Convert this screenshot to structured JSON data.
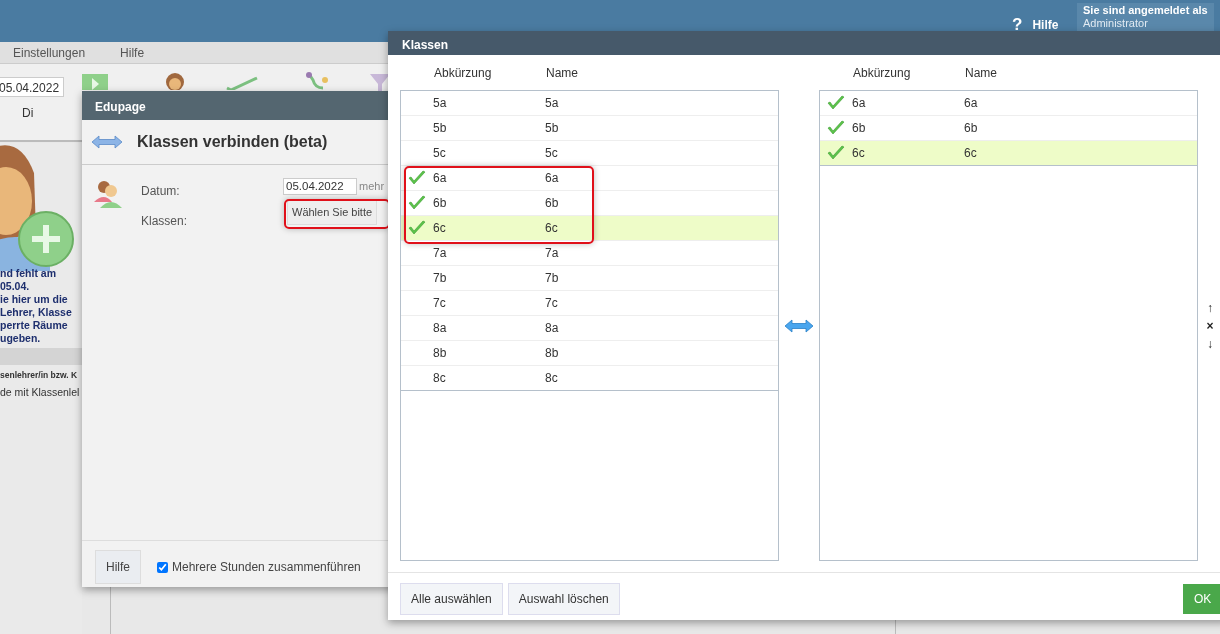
{
  "topbar": {
    "help": "Hilfe",
    "help_mark": "?",
    "user_label": "Sie sind angemeldet als",
    "user_name": "Administrator"
  },
  "menu": [
    "Einstellungen",
    "Hilfe"
  ],
  "toolbar": {
    "date": "05.04.2022",
    "day": "Di"
  },
  "side_panel": {
    "message": "nd fehlt am\n05.04.\nie hier um die\nLehrer, Klasse\nperrte Räume\nugeben.",
    "note": "senlehrer/in bzw. K",
    "text": "de mit Klassenlel"
  },
  "edupage_dialog": {
    "title": "Edupage",
    "heading": "Klassen verbinden (beta)",
    "date_label": "Datum:",
    "date_value": "05.04.2022",
    "more": "mehr",
    "classes_label": "Klassen:",
    "classes_button": "Wählen Sie bitte",
    "help_button": "Hilfe",
    "merge": {
      "label": "Mehrere Stunden zusammenführen",
      "checked": true
    }
  },
  "classes_dialog": {
    "title": "Klassen",
    "columns": [
      "Abkürzung",
      "Name"
    ],
    "chosen_columns": [
      "Abkürzung",
      "Name"
    ],
    "available": [
      {
        "abbr": "5a",
        "name": "5a",
        "checked": false,
        "selected": false
      },
      {
        "abbr": "5b",
        "name": "5b",
        "checked": false,
        "selected": false
      },
      {
        "abbr": "5c",
        "name": "5c",
        "checked": false,
        "selected": false
      },
      {
        "abbr": "6a",
        "name": "6a",
        "checked": true,
        "selected": false
      },
      {
        "abbr": "6b",
        "name": "6b",
        "checked": true,
        "selected": false
      },
      {
        "abbr": "6c",
        "name": "6c",
        "checked": true,
        "selected": true
      },
      {
        "abbr": "7a",
        "name": "7a",
        "checked": false,
        "selected": false
      },
      {
        "abbr": "7b",
        "name": "7b",
        "checked": false,
        "selected": false
      },
      {
        "abbr": "7c",
        "name": "7c",
        "checked": false,
        "selected": false
      },
      {
        "abbr": "8a",
        "name": "8a",
        "checked": false,
        "selected": false
      },
      {
        "abbr": "8b",
        "name": "8b",
        "checked": false,
        "selected": false
      },
      {
        "abbr": "8c",
        "name": "8c",
        "checked": false,
        "selected": false
      }
    ],
    "chosen": [
      {
        "abbr": "6a",
        "name": "6a",
        "checked": true,
        "selected": false
      },
      {
        "abbr": "6b",
        "name": "6b",
        "checked": true,
        "selected": false
      },
      {
        "abbr": "6c",
        "name": "6c",
        "checked": true,
        "selected": true
      }
    ],
    "order_controls": [
      "↑",
      "×",
      "↓"
    ],
    "buttons": [
      "Alle auswählen",
      "Auswahl löschen"
    ],
    "ok": "OK"
  }
}
